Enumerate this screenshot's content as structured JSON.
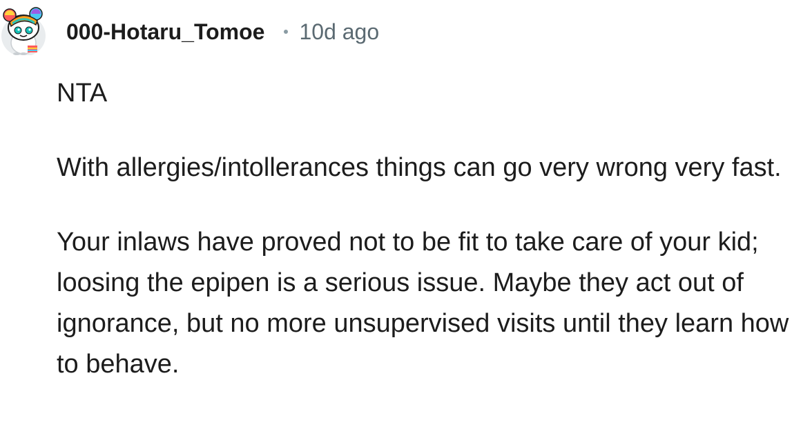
{
  "comment": {
    "username": "000-Hotaru_Tomoe",
    "age": "10d ago",
    "avatar_icon": "snoo-avatar-icon",
    "paragraphs": [
      "NTA",
      "With allergies/intollerances things can go very wrong very fast.",
      "Your inlaws have proved not to be fit to take care of your kid; loosing the epipen is a serious issue. Maybe they act out of ignorance, but no more unsupervised visits until they learn how to behave."
    ]
  },
  "colors": {
    "username": "#1c1c1c",
    "meta": "#5b6a72",
    "text": "#1c1c1c",
    "background": "#ffffff"
  }
}
